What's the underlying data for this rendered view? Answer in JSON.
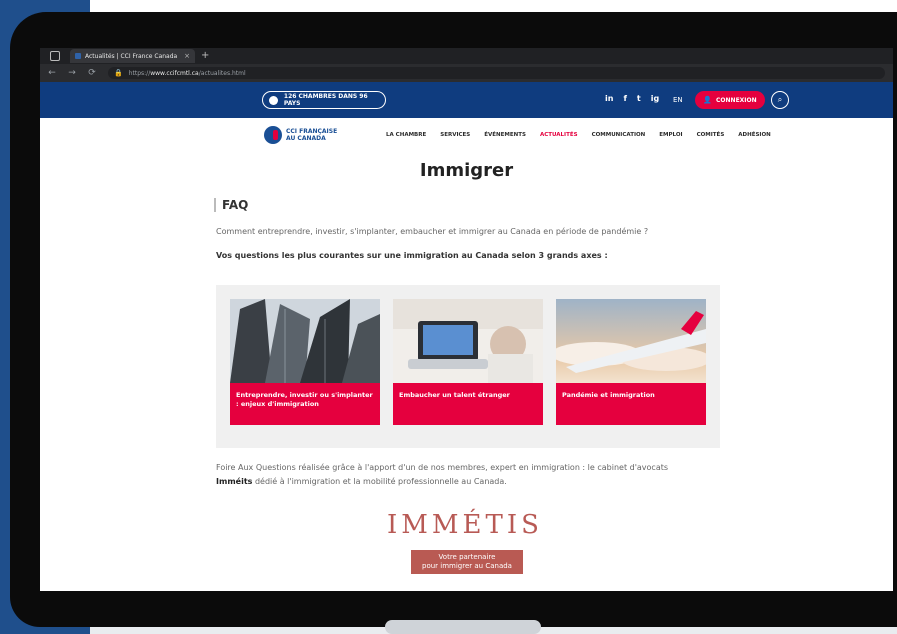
{
  "browser": {
    "tab_title": "Actualités | CCI France Canada",
    "url_prefix": "https://",
    "url_domain": "www.ccifcmtl.ca",
    "url_path": "/actualites.html",
    "icons": [
      "window-icon",
      "back-icon",
      "forward-icon",
      "reload-icon",
      "lock-icon",
      "new-tab-icon"
    ]
  },
  "topbar": {
    "chambers_label": "126 CHAMBRES DANS 96 PAYS",
    "social": [
      "in",
      "f",
      "t",
      "ig"
    ],
    "lang": "EN",
    "login_label": "CONNEXION",
    "colors": {
      "bar": "#0f3c7f",
      "accent": "#e5003e"
    }
  },
  "nav": {
    "logo_text_1": "CCI FRANÇAISE",
    "logo_text_2": "AU CANADA",
    "items": [
      "LA CHAMBRE",
      "SERVICES",
      "ÉVÉNEMENTS",
      "ACTUALITÉS",
      "COMMUNICATION",
      "EMPLOI",
      "COMITÉS",
      "ADHÉSION"
    ],
    "active": "ACTUALITÉS"
  },
  "main": {
    "title": "Immigrer",
    "section": "FAQ",
    "intro": "Comment entreprendre, investir, s'implanter, embaucher et immigrer au Canada en période de pandémie ?",
    "lead": "Vos questions les plus courantes sur une immigration au Canada selon 3 grands axes :",
    "cards": [
      {
        "label": "Entreprendre, investir ou s'implanter : enjeux d'immigration"
      },
      {
        "label": "Embaucher un talent étranger"
      },
      {
        "label": "Pandémie et immigration"
      }
    ],
    "footer_text_1": "Foire Aux Questions réalisée grâce à l'apport d'un de nos membres, expert en immigration : le cabinet d'avocats",
    "footer_strong": "Imméits",
    "footer_text_2": "dédié à l'immigration et la mobilité professionnelle au Canada."
  },
  "partner": {
    "logo_text": "IMMÉTIS",
    "tagline_1": "Votre partenaire",
    "tagline_2": "pour immigrer au Canada"
  }
}
